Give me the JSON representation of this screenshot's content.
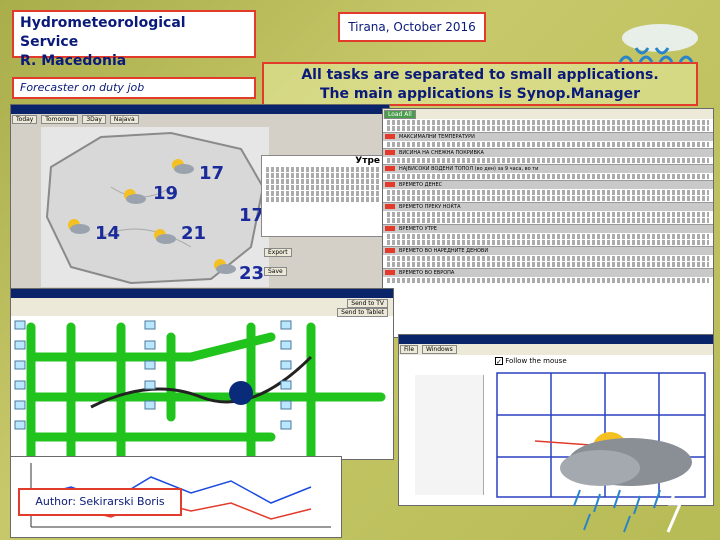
{
  "slide": {
    "title_line1": "Hydrometeorological Service",
    "title_line2": "R. Macedonia",
    "date": "Tirana, October 2016",
    "job": "Forecaster on duty job",
    "headline_line1": "All tasks are separated to small applications.",
    "headline_line2": "The main applications is Synop.Manager",
    "author": "Author: Sekirarski Boris"
  },
  "map_window": {
    "tabs": [
      "Today",
      "Tomorrow",
      "3Day",
      "Najava"
    ],
    "numbers": [
      "17",
      "19",
      "17",
      "14",
      "21",
      "23"
    ],
    "forecast_label": "Утре",
    "buttons": [
      "Export",
      "Save"
    ]
  },
  "synop_window": {
    "sections": [
      "МАКСИМАЛНИ ТЕМПЕРАТУРИ",
      "ВИСИНА НА СНЕЖНА ПОКРИВКА",
      "НАЈВИСОКИ ВОДЕНИ ТОПОЛ (во ден) за 9 часа, во ти",
      "ВРЕМЕТО ДЕНЕС",
      "ВРЕМЕТО ПРЕКУ НОЌТА",
      "ВРЕМЕТО УТРЕ",
      "ВРЕМЕТО ВО НАРЕДНИТЕ ДЕНОВИ",
      "ВРЕМЕТО ВО ЕВРОПА"
    ],
    "load_button": "Load All"
  },
  "route_window": {
    "buttons": [
      "Send to TV",
      "Send to Tablet"
    ]
  },
  "follow_window": {
    "checkbox_label": "Follow the mouse",
    "menu": [
      "File",
      "Windows"
    ]
  },
  "colors": {
    "label_border": "#e23b2c",
    "text_blue": "#0a1a7a",
    "route_green": "#21c41c"
  }
}
